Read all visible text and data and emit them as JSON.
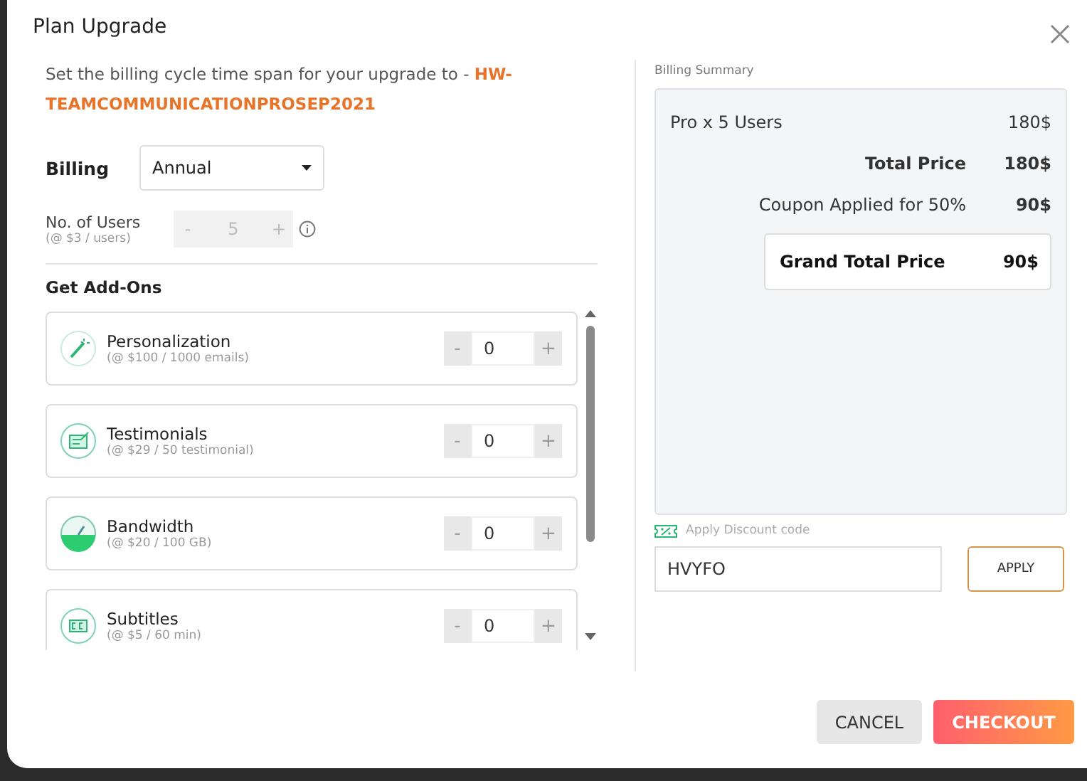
{
  "window": {
    "title": "Plan Upgrade"
  },
  "intro": {
    "text": "Set the billing cycle time span for your upgrade to - ",
    "plan": "HW-TEAMCOMMUNICATIONPROSEP2021"
  },
  "billing": {
    "label": "Billing",
    "value": "Annual"
  },
  "users": {
    "label": "No. of Users",
    "rate": "(@ $3 / users)",
    "minus": "-",
    "value": "5",
    "plus": "+",
    "disabled": true
  },
  "addons_title": "Get Add-Ons",
  "addons": [
    {
      "kind": "wand",
      "name": "Personalization",
      "rate": "(@ $100 / 1000 emails)",
      "minus": "-",
      "value": "0",
      "plus": "+"
    },
    {
      "kind": "form",
      "name": "Testimonials",
      "rate": "(@ $29 / 50 testimonial)",
      "minus": "-",
      "value": "0",
      "plus": "+"
    },
    {
      "kind": "gauge",
      "name": "Bandwidth",
      "rate": "(@ $20 / 100 GB)",
      "minus": "-",
      "value": "0",
      "plus": "+"
    },
    {
      "kind": "cc",
      "name": "Subtitles",
      "rate": "(@ $5 / 60 min)",
      "minus": "-",
      "value": "0",
      "plus": "+"
    }
  ],
  "summary": {
    "title": "Billing Summary",
    "rows": [
      {
        "kind": "line",
        "label": "Pro x 5 Users",
        "amount": "180$"
      },
      {
        "kind": "total",
        "label": "Total Price",
        "amount": "180$"
      },
      {
        "kind": "discount",
        "label": "Coupon Applied for 50%",
        "amount": "90$"
      }
    ],
    "grand": {
      "label": "Grand Total Price",
      "amount": "90$"
    }
  },
  "discount": {
    "label": "Apply Discount code",
    "value": "HVYFO",
    "button": "APPLY"
  },
  "buttons": {
    "cancel": "CANCEL",
    "checkout": "CHECKOUT"
  }
}
